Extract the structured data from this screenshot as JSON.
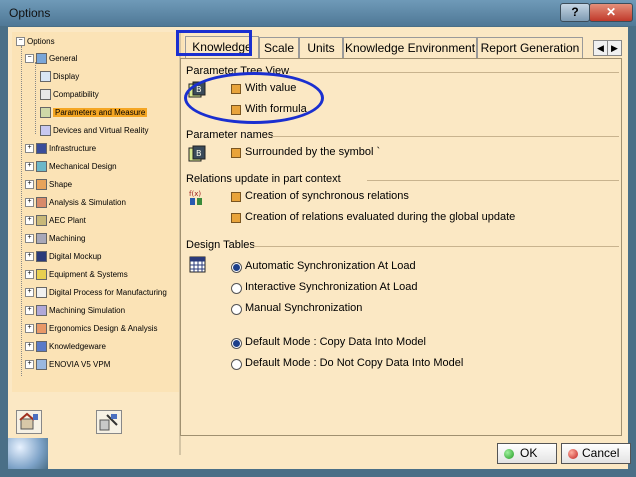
{
  "window": {
    "title": "Options",
    "help": "?",
    "close": "✕"
  },
  "tree": {
    "items": [
      {
        "label": "Options",
        "level": 0
      },
      {
        "label": "General",
        "level": 1
      },
      {
        "label": "Display",
        "level": 2
      },
      {
        "label": "Compatibility",
        "level": 2
      },
      {
        "label": "Parameters and Measure",
        "level": 2,
        "selected": true
      },
      {
        "label": "Devices and Virtual Reality",
        "level": 2
      },
      {
        "label": "Infrastructure",
        "level": 1
      },
      {
        "label": "Mechanical Design",
        "level": 1
      },
      {
        "label": "Shape",
        "level": 1
      },
      {
        "label": "Analysis & Simulation",
        "level": 1
      },
      {
        "label": "AEC Plant",
        "level": 1
      },
      {
        "label": "Machining",
        "level": 1
      },
      {
        "label": "Digital Mockup",
        "level": 1
      },
      {
        "label": "Equipment & Systems",
        "level": 1
      },
      {
        "label": "Digital Process for Manufacturing",
        "level": 1
      },
      {
        "label": "Machining Simulation",
        "level": 1
      },
      {
        "label": "Ergonomics Design & Analysis",
        "level": 1
      },
      {
        "label": "Knowledgeware",
        "level": 1
      },
      {
        "label": "ENOVIA V5 VPM",
        "level": 1
      }
    ]
  },
  "tabs": [
    "Knowledge",
    "Scale",
    "Units",
    "Knowledge Environment",
    "Report Generation"
  ],
  "tab_arrows": {
    "left": "◀",
    "right": "▶"
  },
  "sections": {
    "tree_view": {
      "title": "Parameter Tree View",
      "options": [
        "With value",
        "With formula"
      ]
    },
    "names": {
      "title": "Parameter names",
      "options": [
        "Surrounded by the symbol `"
      ]
    },
    "relations": {
      "title": "Relations update in part context",
      "options": [
        "Creation of synchronous relations",
        "Creation of relations evaluated during the global update"
      ]
    },
    "design_tables": {
      "title": "Design Tables",
      "sync": [
        "Automatic Synchronization At Load",
        "Interactive Synchronization At Load",
        "Manual Synchronization"
      ],
      "mode": [
        "Default Mode : Copy Data Into Model",
        "Default Mode : Do Not Copy Data Into Model"
      ]
    }
  },
  "buttons": {
    "ok": "OK",
    "cancel": "Cancel"
  },
  "colors": {
    "highlight": "#1a2fd0",
    "selected": "#f5a623",
    "checkbox": "#e8a33a"
  }
}
